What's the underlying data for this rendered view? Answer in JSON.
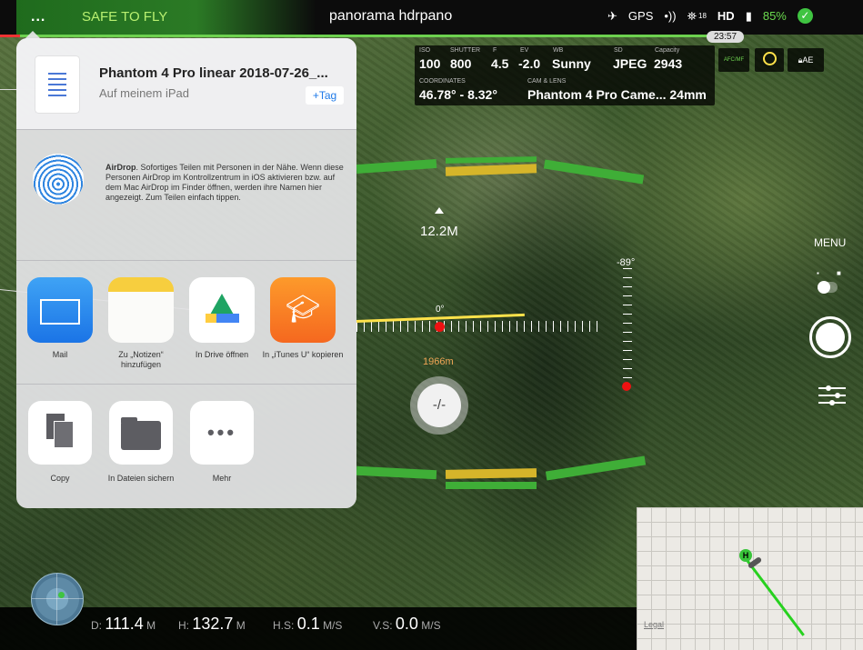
{
  "topbar": {
    "menu_dots": "...",
    "flight_status": "SAFE TO FLY",
    "mode": "panorama hdrpano",
    "gps_label": "GPS",
    "gps_sat_count": "18",
    "hd_label": "HD",
    "battery": "85%",
    "clock": "23:57"
  },
  "camera": {
    "iso_label": "ISO",
    "iso": "100",
    "shutter_label": "SHUTTER",
    "shutter": "800",
    "f_label": "F",
    "f": "4.5",
    "ev_label": "EV",
    "ev": "-2.0",
    "wb_label": "WB",
    "wb": "Sunny",
    "sd_label": "SD",
    "format": "JPEG",
    "capacity_label": "Capacity",
    "capacity": "2943",
    "coordinates_label": "COORDINATES",
    "coordinates": "46.78° - 8.32°",
    "cam_lens_label": "CAM & LENS",
    "cam_lens": "Phantom 4 Pro Came... 24mm",
    "afc_label": "AFC/MF",
    "ae_label": "AE"
  },
  "hud": {
    "altitude": "12.2M",
    "pitch": "-89°",
    "heading_zero": "0°",
    "distance": "1966m",
    "center_button": "-/-"
  },
  "right_panel": {
    "menu": "MENU"
  },
  "telemetry": {
    "d_label": "D:",
    "d_value": "111.4",
    "d_unit": "M",
    "h_label": "H:",
    "h_value": "132.7",
    "h_unit": "M",
    "hs_label": "H.S:",
    "hs_value": "0.1",
    "hs_unit": "M/S",
    "vs_label": "V.S:",
    "vs_value": "0.0",
    "vs_unit": "M/S"
  },
  "map": {
    "legal": "Legal",
    "home_marker": "H"
  },
  "share_sheet": {
    "file_title": "Phantom 4 Pro linear 2018-07-26_...",
    "file_location": "Auf meinem iPad",
    "tag_button": "+Tag",
    "airdrop_title": "AirDrop",
    "airdrop_text": ". Sofortiges Teilen mit Personen in der Nähe. Wenn diese Personen AirDrop im Kontrollzentrum in iOS aktivieren bzw. auf dem Mac AirDrop im Finder öffnen, werden ihre Namen hier angezeigt. Zum Teilen einfach tippen.",
    "apps": [
      {
        "label": "Mail",
        "icon": "mail-icon"
      },
      {
        "label": "Zu „Notizen“ hinzufügen",
        "icon": "notes-icon"
      },
      {
        "label": "In Drive öffnen",
        "icon": "google-drive-icon"
      },
      {
        "label": "In „iTunes U“ kopieren",
        "icon": "itunes-u-icon"
      }
    ],
    "actions": [
      {
        "label": "Copy",
        "icon": "copy-icon"
      },
      {
        "label": "In Dateien sichern",
        "icon": "folder-icon"
      },
      {
        "label": "Mehr",
        "icon": "more-icon"
      }
    ]
  },
  "colors": {
    "safe_green": "#2b7a25",
    "gps_green": "#6dd14f",
    "accent_blue": "#1f7ae8",
    "alert_red": "#e11111",
    "distance_orange": "#f0a555"
  }
}
